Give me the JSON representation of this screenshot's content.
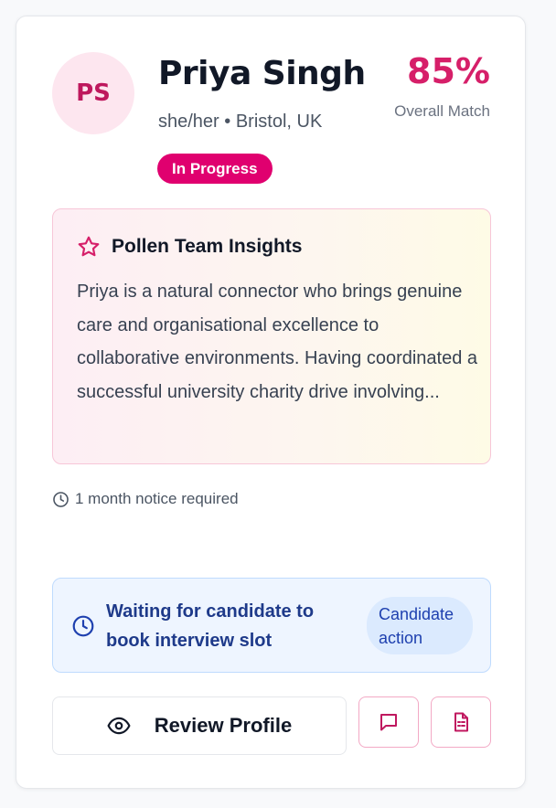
{
  "candidate": {
    "initials": "PS",
    "name": "Priya Singh",
    "pronouns_location": "she/her • Bristol, UK",
    "status": "In Progress",
    "match_percent": "85%",
    "match_label": "Overall Match"
  },
  "insights": {
    "title": "Pollen Team Insights",
    "body": "Priya is a natural connector who brings genuine care and organisational excellence to collaborative environments. Having coordinated a successful university charity drive involving..."
  },
  "notice": {
    "text": "1 month notice required"
  },
  "waiting": {
    "text": "Waiting for candidate to book interview slot",
    "badge": "Candidate action"
  },
  "actions": {
    "review_label": "Review Profile"
  },
  "colors": {
    "accent": "#d61f69",
    "badge_bg": "#e0006f",
    "info_text": "#1e3a8a",
    "info_bg": "#eef5ff"
  },
  "icons": {
    "insights": "star-icon",
    "notice": "clock-icon",
    "waiting": "clock-icon",
    "review": "eye-icon",
    "message": "message-icon",
    "document": "document-icon"
  }
}
